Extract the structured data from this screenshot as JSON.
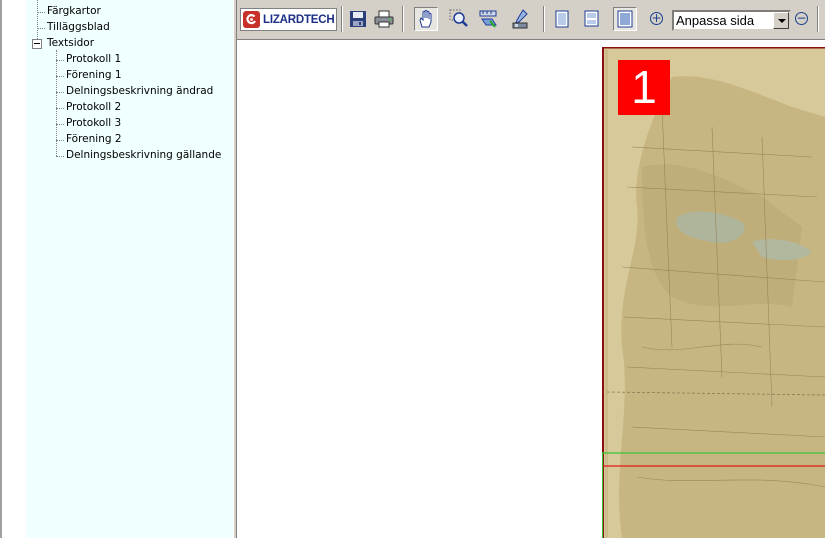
{
  "tree": {
    "items": [
      {
        "label": "Färgkartor"
      },
      {
        "label": "Tilläggsblad"
      },
      {
        "label": "Textsidor"
      }
    ],
    "children": [
      {
        "label": "Protokoll 1"
      },
      {
        "label": "Förening 1"
      },
      {
        "label": "Delningsbeskrivning ändrad"
      },
      {
        "label": "Protokoll 2"
      },
      {
        "label": "Protokoll 3"
      },
      {
        "label": "Förening 2"
      },
      {
        "label": "Delningsbeskrivning gällande"
      }
    ]
  },
  "toolbar": {
    "logo_text": "LIZARDTECH",
    "zoom_value": "Anpassa sida",
    "icons": [
      "save-icon",
      "print-icon",
      "pan-hand-icon",
      "zoom-tool-icon",
      "measure-tool-icon",
      "select-tool-icon",
      "single-page-icon",
      "two-page-icon",
      "fit-page-icon",
      "zoom-in-icon",
      "zoom-out-icon"
    ]
  },
  "viewer": {
    "page_number": "1"
  },
  "colors": {
    "tree_background": "#f0ffff",
    "toolbar_background": "#d4d0c8",
    "page_badge": "#ff0000",
    "map_paper": "#d8c99a",
    "guide_line_green": "#35c835",
    "guide_line_red": "#e21a1a"
  }
}
